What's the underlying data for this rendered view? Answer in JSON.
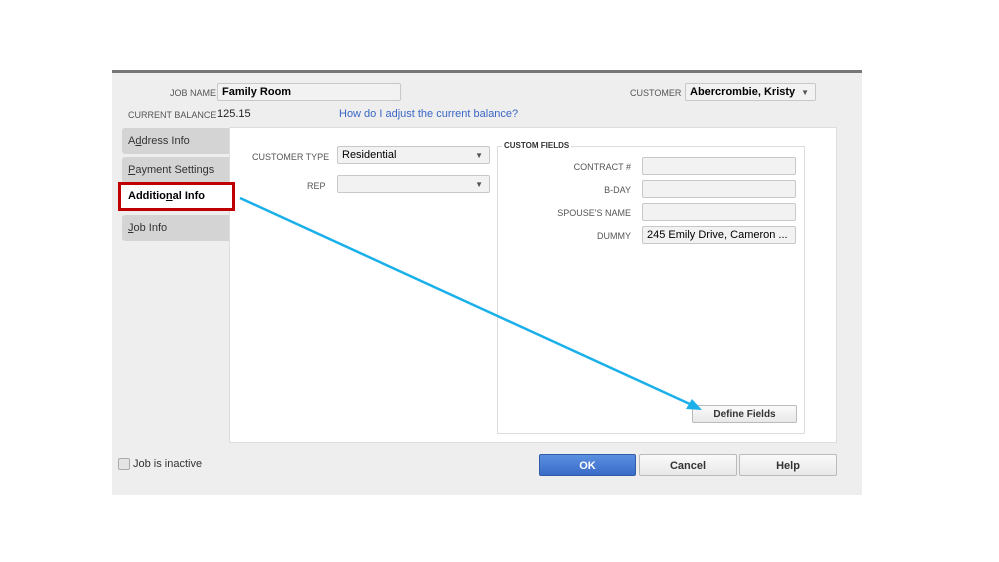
{
  "header": {
    "job_name_label": "JOB NAME",
    "job_name": "Family Room",
    "customer_label": "CUSTOMER",
    "customer": "Abercrombie, Kristy",
    "balance_label": "CURRENT BALANCE",
    "balance": "125.15",
    "balance_help_link": "How do I adjust the current balance?"
  },
  "tabs": [
    {
      "pre": "A",
      "u": "d",
      "post": "dress Info"
    },
    {
      "pre": "",
      "u": "P",
      "post": "ayment Settings"
    },
    {
      "pre": "Additio",
      "u": "n",
      "post": "al Info"
    },
    {
      "pre": "",
      "u": "J",
      "post": "ob Info"
    }
  ],
  "active_tab": "Additional Info",
  "form": {
    "customer_type_label": "CUSTOMER TYPE",
    "customer_type": "Residential",
    "rep_label": "REP",
    "rep": ""
  },
  "custom_fields": {
    "title": "CUSTOM FIELDS",
    "fields": [
      {
        "label": "CONTRACT #",
        "value": ""
      },
      {
        "label": "B-DAY",
        "value": ""
      },
      {
        "label": "SPOUSE'S NAME",
        "value": ""
      },
      {
        "label": "DUMMY",
        "value": "245  Emily Drive, Cameron ..."
      }
    ],
    "define_button": "Define Fields"
  },
  "footer": {
    "inactive_label": "Job is inactive",
    "inactive_checked": false,
    "ok": "OK",
    "cancel": "Cancel",
    "help": "Help"
  },
  "annotation": {
    "highlight_color": "#c00000",
    "arrow_color": "#1ab0ea"
  }
}
